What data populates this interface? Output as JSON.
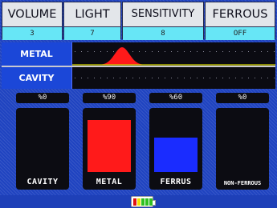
{
  "settings": {
    "volume": {
      "label": "VOLUME",
      "value": "3"
    },
    "light": {
      "label": "LIGHT",
      "value": "7"
    },
    "sensitivity": {
      "label": "SENSITIVITY",
      "value": "8"
    },
    "ferrous": {
      "label": "FERROUS",
      "value": "OFF"
    }
  },
  "signals": {
    "metal_label": "METAL",
    "cavity_label": "CAVITY",
    "metal_color": "#ff1a1a",
    "baseline_color": "#d8d800"
  },
  "meters": [
    {
      "percent_label": "%0",
      "name": "CAVITY",
      "level": 0,
      "color": "#000000"
    },
    {
      "percent_label": "%90",
      "name": "METAL",
      "level": 90,
      "color": "#ff1a1a"
    },
    {
      "percent_label": "%60",
      "name": "FERRUS",
      "level": 60,
      "color": "#1a2cff"
    },
    {
      "percent_label": "%0",
      "name": "NON-FERROUS",
      "level": 0,
      "color": "#000000"
    }
  ],
  "status": {
    "battery_icon": "battery-icon",
    "battery_colors": [
      "#e01010",
      "#f0e000",
      "#30c020",
      "#30c020",
      "#30c020"
    ]
  }
}
